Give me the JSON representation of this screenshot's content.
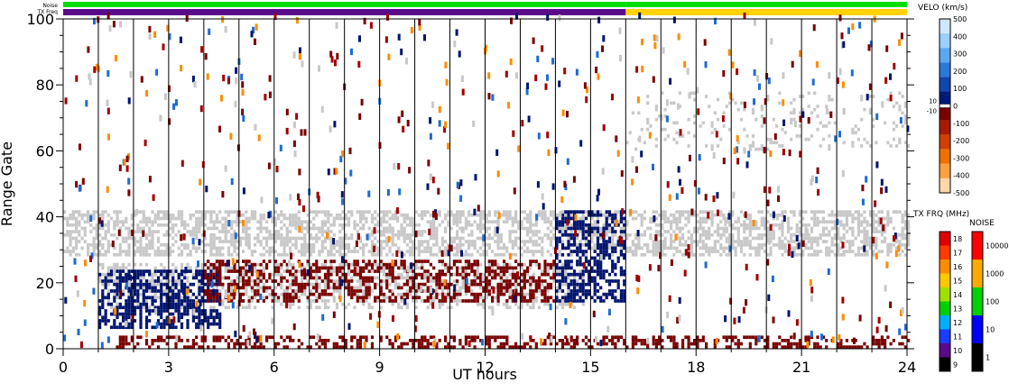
{
  "chart_data": {
    "type": "heatmap",
    "xlabel": "UT hours",
    "ylabel": "Range Gate",
    "xlim": [
      0,
      24
    ],
    "ylim": [
      0,
      100
    ],
    "x_ticks": [
      0,
      3,
      6,
      9,
      12,
      15,
      18,
      21,
      24
    ],
    "y_ticks": [
      0,
      20,
      40,
      60,
      80,
      100
    ],
    "grid": "vertical lines every hour",
    "ground_scatter_color": "#c8c8c8",
    "strips": {
      "noise_label": "Noise",
      "txfreq_label": "TX Freq",
      "segments": [
        {
          "from": 0,
          "to": 16,
          "noise": "#00dd00",
          "tx": "#5a0a8a"
        },
        {
          "from": 16,
          "to": 24,
          "noise": "#00dd00",
          "tx": "#ffd200"
        }
      ]
    },
    "bands": [
      {
        "name": "ground scatter band",
        "t0": 0,
        "t1": 24,
        "g0": 28,
        "g1": 42,
        "color": "#c8c8c8",
        "density": 0.55
      },
      {
        "name": "mid band",
        "t0": 1.0,
        "t1": 14.8,
        "g0": 12,
        "g1": 26,
        "color": "#c8c8c8",
        "density": 0.35
      },
      {
        "name": "blue echoes",
        "t0": 1.0,
        "t1": 4.5,
        "g0": 6,
        "g1": 24,
        "color": "#00146e",
        "density": 0.55
      },
      {
        "name": "red band",
        "t0": 4.0,
        "t1": 14.0,
        "g0": 14,
        "g1": 27,
        "color": "#7a0000",
        "density": 0.45
      },
      {
        "name": "near range red",
        "t0": 1.5,
        "t1": 24,
        "g0": 0,
        "g1": 4,
        "color": "#7a0000",
        "density": 0.45
      },
      {
        "name": "late blue",
        "t0": 14.0,
        "t1": 16.0,
        "g0": 14,
        "g1": 42,
        "color": "#00146e",
        "density": 0.5
      },
      {
        "name": "far gray",
        "t0": 16,
        "t1": 24,
        "g0": 60,
        "g1": 78,
        "color": "#c8c8c8",
        "density": 0.12
      }
    ],
    "velocity_scale": {
      "title": "VELO (km/s)",
      "ticks": [
        "500",
        "400",
        "300",
        "200",
        "100",
        "0",
        "-100",
        "-200",
        "-300",
        "-400",
        "-500"
      ],
      "zero_labels": [
        "10",
        "-10"
      ]
    },
    "txfreq_scale": {
      "title": "TX FRQ (MHz)",
      "ticks": [
        "18",
        "17",
        "16",
        "15",
        "14",
        "13",
        "12",
        "11",
        "10",
        "9"
      ],
      "colors": [
        "#e00000",
        "#ff3a00",
        "#ff8c00",
        "#ffc800",
        "#a0e000",
        "#00d000",
        "#00b0ff",
        "#1a3cff",
        "#5a0a8a",
        "#000000"
      ]
    },
    "noise_scale": {
      "title": "NOISE",
      "ticks": [
        "10000",
        "1000",
        "100",
        "10",
        "1"
      ],
      "colors": [
        "#ff0000",
        "#ffaa00",
        "#00d000",
        "#0000ff",
        "#000000"
      ]
    }
  }
}
